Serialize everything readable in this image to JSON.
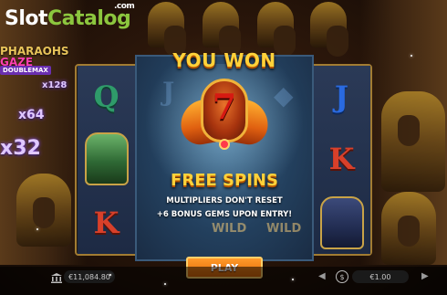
{
  "logo": {
    "part1": "Slot",
    "part2": "Catalog",
    "suffix": ".com"
  },
  "game": {
    "title_line1": "PHARAOHS",
    "title_line2": "GAZE",
    "provider": "DOUBLEMAX"
  },
  "multipliers": [
    "x128",
    "x64",
    "x32"
  ],
  "popup": {
    "heading": "YOU WON",
    "free_spins_count": "7",
    "award_label": "FREE SPINS",
    "info_line1": "MULTIPLIERS DON'T RESET",
    "info_line2": "+6 BONUS GEMS UPON ENTRY!",
    "background_wild_label": "WILD"
  },
  "reels": {
    "left_column": [
      "Q",
      "figure",
      "K"
    ],
    "right_column": [
      "J",
      "K",
      "anubis"
    ]
  },
  "controls": {
    "play_label": "PLAY",
    "balance": "€11,084.80",
    "bet": "€1.00",
    "icons": [
      "bank-icon",
      "coin-stack-icon",
      "arrow-left-icon",
      "arrow-right-icon"
    ]
  },
  "colors": {
    "gold_text": "#ffd23a",
    "play_orange": "#ff9a2a",
    "logo_green": "#8cc63e",
    "frame_gold": "#a27c32"
  }
}
